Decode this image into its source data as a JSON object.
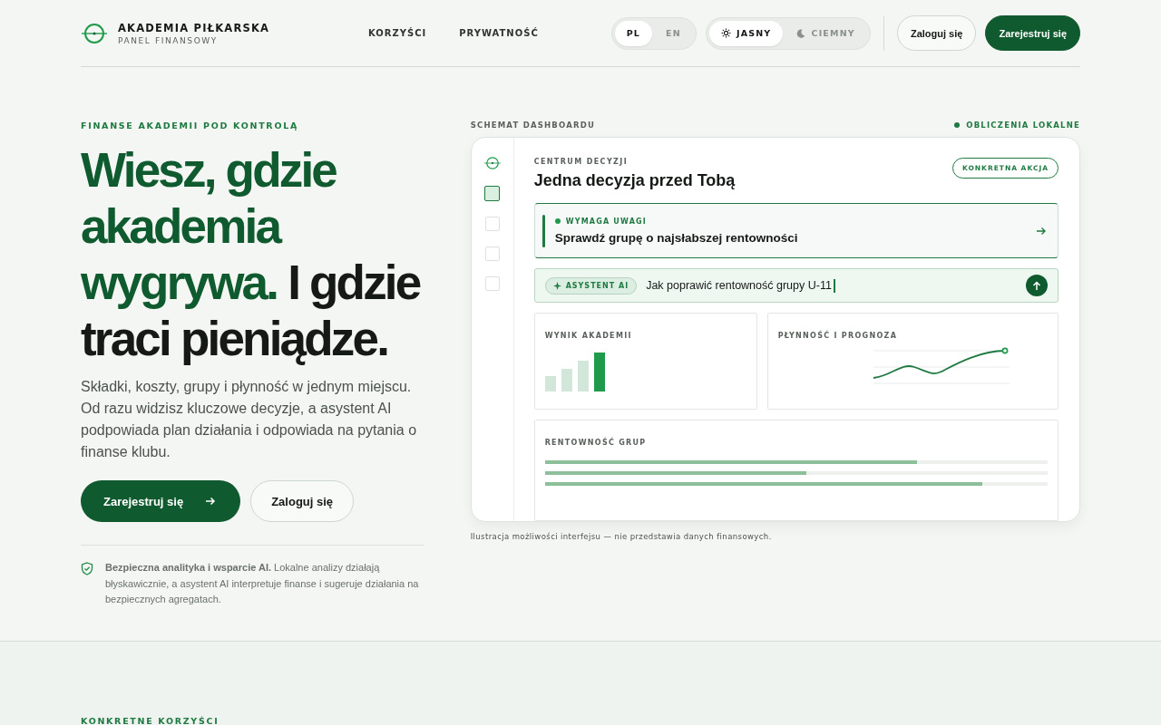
{
  "brand": {
    "name": "AKADEMIA PIŁKARSKA",
    "subtitle": "PANEL FINANSOWY"
  },
  "nav": [
    "KORZYŚCI",
    "PRYWATNOŚĆ"
  ],
  "languages": [
    {
      "label": "PL",
      "selected": true
    },
    {
      "label": "EN",
      "selected": false
    }
  ],
  "themes": [
    {
      "label": "JASNY",
      "kind": "sun",
      "selected": true
    },
    {
      "label": "CIEMNY",
      "kind": "moon",
      "selected": false
    }
  ],
  "header_buttons": [
    {
      "label": "Zaloguj się",
      "kind": "secondary"
    },
    {
      "label": "Zarejestruj się",
      "kind": "primary"
    }
  ],
  "hero": {
    "eyebrow": "FINANSE AKADEMII POD KONTROLĄ",
    "headline": [
      {
        "text": "Wiesz, gdzie",
        "accent": true
      },
      {
        "text": "akademia",
        "accent": true
      },
      {
        "text": "wygrywa.",
        "accent": true
      },
      {
        "text": "I gdzie",
        "accent": false
      },
      {
        "text": "traci pieniądze.",
        "accent": false
      }
    ],
    "lead": "Składki, koszty, grupy i płynność w jednym miejscu. Od razu widzisz kluczowe decyzje, a asystent AI podpowiada plan działania i odpowiada na pytania o finanse klubu.",
    "buttons": [
      {
        "label": "Zarejestruj się",
        "kind": "primary"
      },
      {
        "label": "Zaloguj się",
        "kind": "secondary"
      }
    ],
    "note": "**Bezpieczna analityka i wsparcie AI.** Lokalne analizy działają błyskawicznie, a asystent AI interpretuje finanse i sugeruje działania na bezpiecznych agregatach."
  },
  "dashboard": {
    "label": "SCHEMAT DASHBOARDU",
    "status": "OBLICZENIA LOKALNE",
    "sidebar": [
      {
        "selected": true
      },
      {
        "selected": false
      },
      {
        "selected": false
      },
      {
        "selected": false
      }
    ],
    "eyebrow": "CENTRUM DECYZJI",
    "title": "Jedna decyzja przed Tobą",
    "badge": "KONKRETNA AKCJA",
    "alert": {
      "label": "WYMAGA UWAGI",
      "text": "Sprawdź grupę o najsłabszej rentowności"
    },
    "assistant": {
      "tag": "ASYSTENT AI",
      "value": "Jak poprawić rentowność grupy U-11"
    },
    "score_title": "WYNIK AKADEMII",
    "liquidity_title": "PŁYNNOŚĆ I PROGNOZA",
    "groups_title": "RENTOWNOŚĆ GRUP",
    "groups": [
      {
        "level": 0.74
      },
      {
        "level": 0.52
      },
      {
        "level": 0.87
      }
    ],
    "caption": "Ilustracja możliwości interfejsu — nie przedstawia danych finansowych."
  },
  "next_section": {
    "eyebrow": "KONKRETNE KORZYŚCI"
  }
}
